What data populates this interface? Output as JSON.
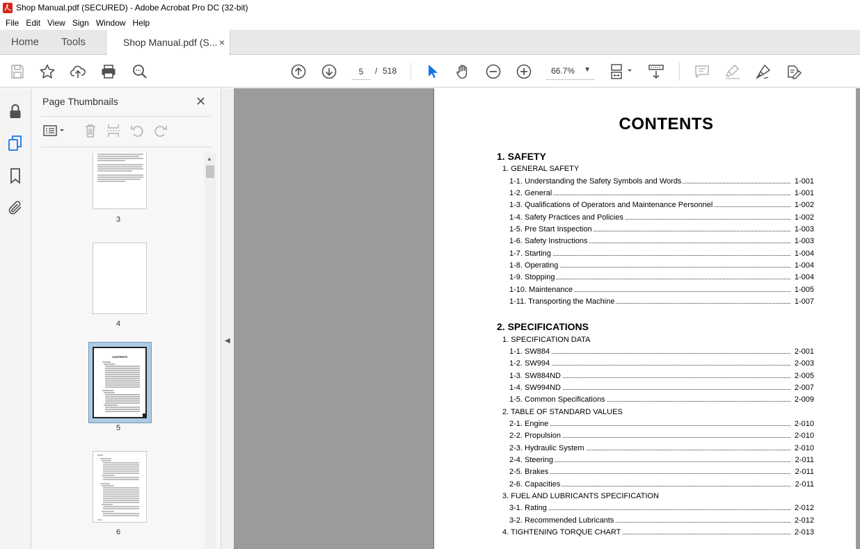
{
  "window": {
    "title": "Shop Manual.pdf (SECURED) - Adobe Acrobat Pro DC (32-bit)"
  },
  "menu": [
    "File",
    "Edit",
    "View",
    "Sign",
    "Window",
    "Help"
  ],
  "tabs": {
    "home": "Home",
    "tools": "Tools",
    "document": "Shop Manual.pdf (S...",
    "close": "×"
  },
  "toolbar": {
    "current_page": "5",
    "page_separator": "/",
    "total_pages": "518",
    "zoom": "66.7%"
  },
  "thumbnails_panel": {
    "title": "Page Thumbnails",
    "close": "✕",
    "pages": [
      {
        "number": "3"
      },
      {
        "number": "4"
      },
      {
        "number": "5",
        "selected": true
      },
      {
        "number": "6"
      }
    ]
  },
  "document": {
    "heading": "CONTENTS",
    "sections": [
      {
        "title": "1. SAFETY",
        "groups": [
          {
            "title": "1. GENERAL SAFETY",
            "entries": [
              {
                "label": "1-1. Understanding the Safety Symbols and Words",
                "page": "1-001"
              },
              {
                "label": "1-2. General",
                "page": "1-001"
              },
              {
                "label": "1-3. Qualifications of Operators and Maintenance Personnel",
                "page": "1-002"
              },
              {
                "label": "1-4. Safety Practices and Policies",
                "page": "1-002"
              },
              {
                "label": "1-5. Pre Start Inspection",
                "page": "1-003"
              },
              {
                "label": "1-6. Safety Instructions",
                "page": "1-003"
              },
              {
                "label": "1-7. Starting",
                "page": "1-004"
              },
              {
                "label": "1-8. Operating",
                "page": "1-004"
              },
              {
                "label": "1-9. Stopping",
                "page": "1-004"
              },
              {
                "label": "1-10. Maintenance",
                "page": "1-005"
              },
              {
                "label": "1-11. Transporting the Machine",
                "page": "1-007"
              }
            ]
          }
        ]
      },
      {
        "title": "2. SPECIFICATIONS",
        "groups": [
          {
            "title": "1. SPECIFICATION DATA",
            "entries": [
              {
                "label": "1-1. SW884",
                "page": "2-001"
              },
              {
                "label": "1-2. SW994",
                "page": "2-003"
              },
              {
                "label": "1-3. SW884ND",
                "page": "2-005"
              },
              {
                "label": "1-4. SW994ND",
                "page": "2-007"
              },
              {
                "label": "1-5. Common Specifications",
                "page": "2-009"
              }
            ]
          },
          {
            "title": "2. TABLE OF STANDARD VALUES",
            "entries": [
              {
                "label": "2-1. Engine",
                "page": "2-010"
              },
              {
                "label": "2-2. Propulsion",
                "page": "2-010"
              },
              {
                "label": "2-3. Hydraulic System",
                "page": "2-010"
              },
              {
                "label": "2-4. Steering",
                "page": "2-011"
              },
              {
                "label": "2-5. Brakes",
                "page": "2-011"
              },
              {
                "label": "2-6. Capacities",
                "page": "2-011"
              }
            ]
          },
          {
            "title": "3. FUEL AND LUBRICANTS SPECIFICATION",
            "entries": [
              {
                "label": "3-1. Rating",
                "page": "2-012"
              },
              {
                "label": "3-2. Recommended Lubricants",
                "page": "2-012"
              }
            ]
          },
          {
            "title": "4. TIGHTENING TORQUE CHART",
            "page": "2-013",
            "entries": []
          }
        ]
      }
    ]
  }
}
